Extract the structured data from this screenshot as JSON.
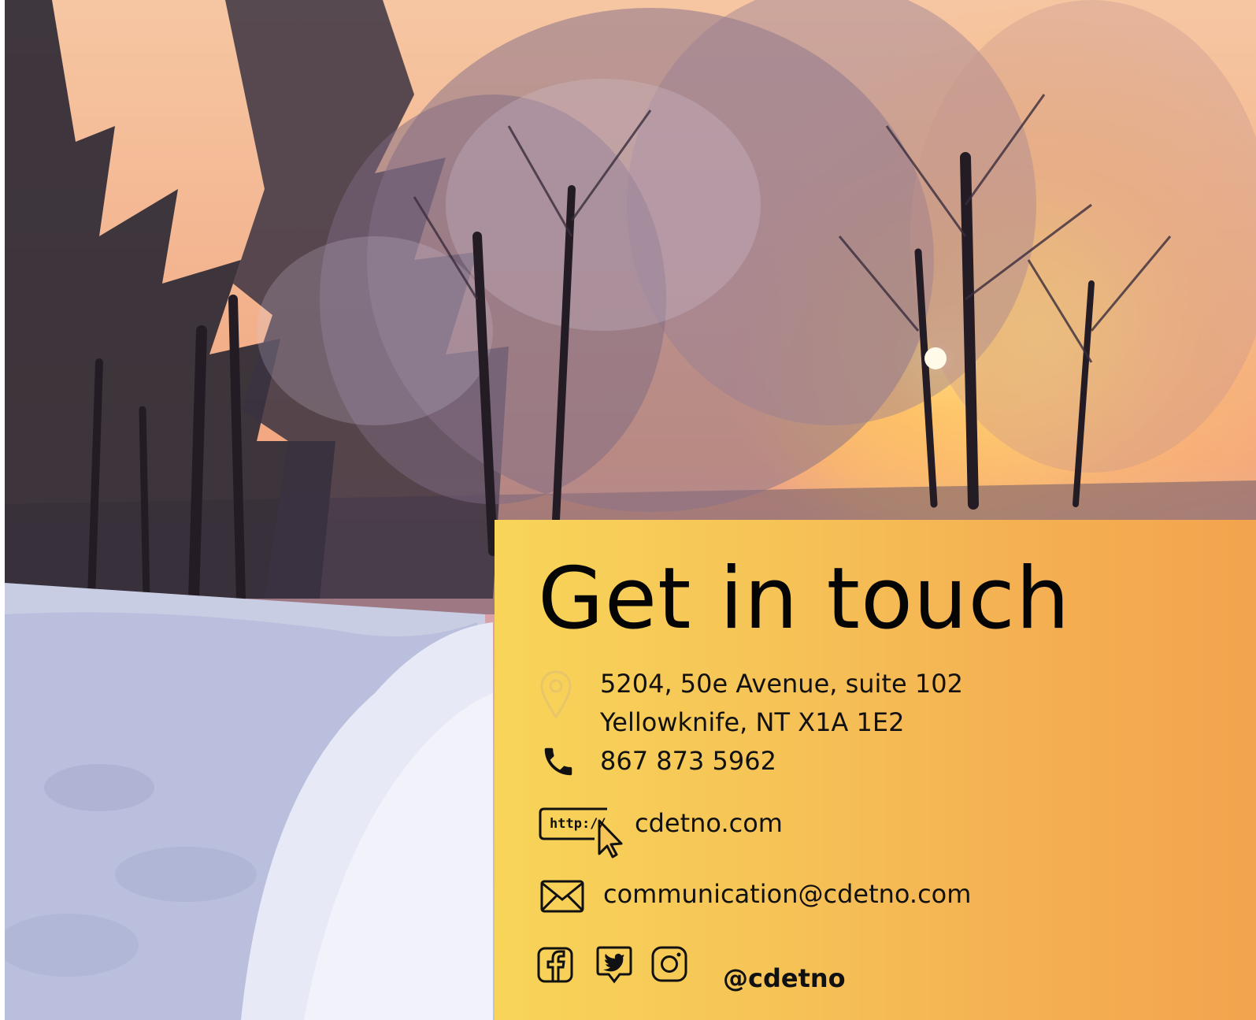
{
  "contact": {
    "title": "Get in touch",
    "address_line1": "5204, 50e Avenue, suite 102",
    "address_line2": "Yellowknife, NT X1A 1E2",
    "phone": "867 873 5962",
    "website_icon_text": "http://",
    "website": "cdetno.com",
    "email": "communication@cdetno.com",
    "social_handle": "@cdetno"
  },
  "icons": {
    "address": "map-pin-icon",
    "phone": "phone-icon",
    "website": "http-cursor-icon",
    "email": "envelope-icon",
    "facebook": "facebook-icon",
    "twitter": "twitter-icon",
    "instagram": "instagram-icon"
  },
  "colors": {
    "card_start": "#f8d558",
    "card_end": "#f3a44e",
    "text": "#111111"
  }
}
